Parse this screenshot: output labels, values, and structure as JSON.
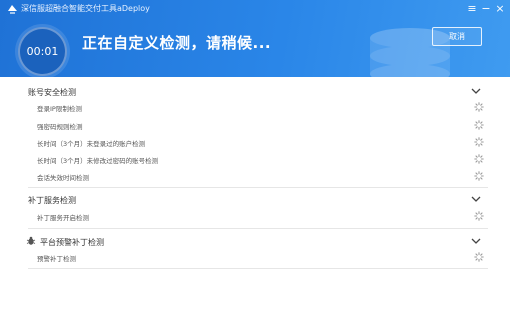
{
  "window": {
    "app_title": "深信服超融合智能交付工具aDeploy",
    "menu_icon": "menu-icon",
    "minimize_icon": "minimize-icon",
    "close_icon": "close-icon"
  },
  "header": {
    "timer": "00:01",
    "status_title": "正在自定义检测，请稍候...",
    "cancel_label": "取消",
    "accent": "#2a86e8"
  },
  "groups": [
    {
      "title": "账号安全检测",
      "items": [
        "登录IP限制检测",
        "强密码规则检测",
        "长时间（3个月）未登录过的账户检测",
        "长时间（3个月）未修改过密码的账号检测",
        "会话失效时间检测"
      ]
    },
    {
      "title": "补丁服务检测",
      "items": [
        "补丁服务开启检测"
      ]
    },
    {
      "title": "平台预警补丁检测",
      "items": [
        "预警补丁检测"
      ]
    }
  ]
}
